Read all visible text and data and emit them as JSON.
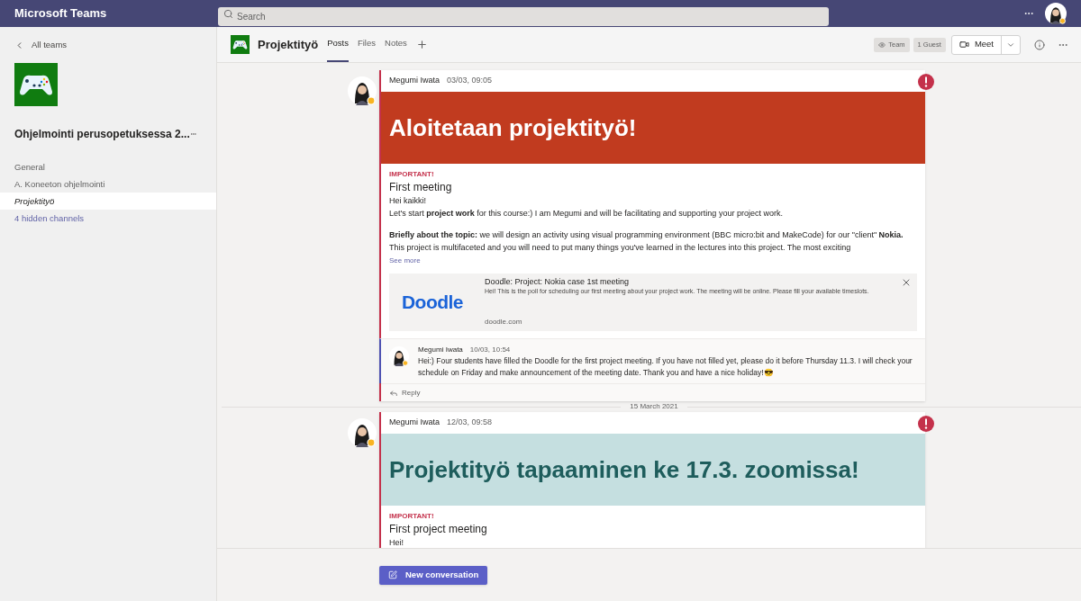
{
  "app": {
    "title": "Microsoft Teams"
  },
  "search": {
    "placeholder": "Search"
  },
  "sidebar": {
    "back": "All teams",
    "team_name": "Ohjelmointi perusopetuksessa 2...",
    "channels": [
      {
        "label": "General",
        "selected": false
      },
      {
        "label": "A. Koneeton ohjelmointi",
        "selected": false
      },
      {
        "label": "Projektityö",
        "selected": true
      }
    ],
    "hidden_channels": "4 hidden channels"
  },
  "header": {
    "channel": "Projektityö",
    "tabs": [
      {
        "label": "Posts",
        "selected": true
      },
      {
        "label": "Files",
        "selected": false
      },
      {
        "label": "Notes",
        "selected": false
      }
    ],
    "badges": [
      "Team",
      "1 Guest"
    ],
    "meet": "Meet"
  },
  "feed": [
    {
      "kind": "post",
      "author": "Megumi Iwata",
      "time": "03/03, 09:05",
      "important": true,
      "banner": {
        "text": "Aloitetaan projektityö!",
        "color": "#c13b1f"
      },
      "label": "IMPORTANT!",
      "subject": "First meeting",
      "body": [
        "Hei kaikki!",
        "Let's start **project work** for this course:) I am Megumi and will be facilitating and supporting your project work.",
        "**Briefly about the topic:** we will design an activity using visual programming environment (BBC micro:bit and MakeCode) for our \"client\" **Nokia.** This project is multifaceted and you will need to put many things you've learned in the lectures into this project. The most exciting"
      ],
      "see_more": "See more",
      "preview": {
        "logo": "Doodle",
        "title": "Doodle: Project: Nokia case 1st meeting",
        "text": "Hei! This is the poll for scheduling our first meeting about your project work. The meeting will be online. Please fill your available timeslots.",
        "domain": "doodle.com"
      },
      "replies": [
        {
          "author": "Megumi Iwata",
          "time": "10/03, 10:54",
          "text": "Hei:) Four students have filled the Doodle for the first project meeting. If you have not filled yet, please do it before Thursday 11.3. I will check your schedule on Friday and make announcement of the meeting date. Thank you and have a nice holiday!😎"
        }
      ],
      "reply_link": "Reply"
    },
    {
      "kind": "date",
      "text": "15 March 2021"
    },
    {
      "kind": "post",
      "author": "Megumi Iwata",
      "time": "12/03, 09:58",
      "important": true,
      "banner": {
        "text": "Projektityö tapaaminen ke 17.3. zoomissa!",
        "color": "#c5dfe0"
      },
      "label": "IMPORTANT!",
      "subject": "First project meeting",
      "body": [
        "Hei!"
      ]
    }
  ],
  "new_conversation": "New conversation"
}
